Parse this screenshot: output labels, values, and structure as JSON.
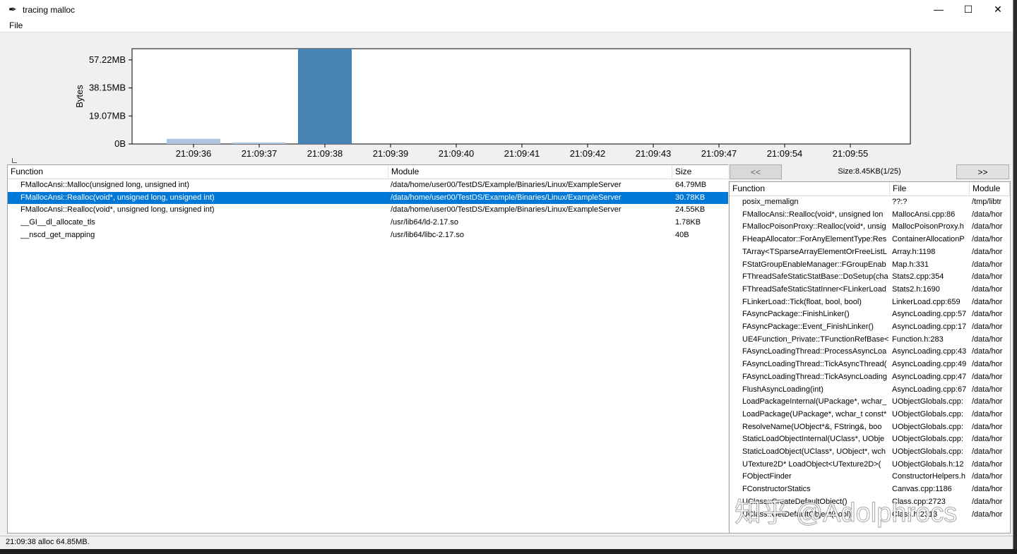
{
  "window": {
    "title": "tracing malloc",
    "menu": [
      "File"
    ],
    "minimize_icon": "minimize-icon",
    "maximize_icon": "maximize-icon",
    "close_icon": "close-icon"
  },
  "chart_data": {
    "type": "bar",
    "ylabel": "Bytes",
    "yticks": [
      "0B",
      "19.07MB",
      "38.15MB",
      "57.22MB"
    ],
    "ylim_mb": [
      0,
      64.85
    ],
    "categories": [
      "21:09:36",
      "21:09:37",
      "21:09:38",
      "21:09:39",
      "21:09:40",
      "21:09:41",
      "21:09:42",
      "21:09:43",
      "21:09:47",
      "21:09:54",
      "21:09:55"
    ],
    "values_mb": [
      3.5,
      1.0,
      64.85,
      0,
      0,
      0,
      0,
      0,
      0,
      0,
      0
    ],
    "selected_index": 2,
    "colors": {
      "normal": "#aec4dc",
      "selected": "#4682b4"
    }
  },
  "alloc_table": {
    "headers": {
      "function": "Function",
      "module": "Module",
      "size": "Size"
    },
    "rows": [
      {
        "function": "FMallocAnsi::Malloc(unsigned long, unsigned int)",
        "module": "/data/home/user00/TestDS/Example/Binaries/Linux/ExampleServer",
        "size": "64.79MB"
      },
      {
        "function": "FMallocAnsi::Realloc(void*, unsigned long, unsigned int)",
        "module": "/data/home/user00/TestDS/Example/Binaries/Linux/ExampleServer",
        "size": "30.78KB"
      },
      {
        "function": "FMallocAnsi::Realloc(void*, unsigned long, unsigned int)",
        "module": "/data/home/user00/TestDS/Example/Binaries/Linux/ExampleServer",
        "size": "24.55KB"
      },
      {
        "function": "__GI__dl_allocate_tls",
        "module": "/usr/lib64/ld-2.17.so",
        "size": "1.78KB"
      },
      {
        "function": "__nscd_get_mapping",
        "module": "/usr/lib64/libc-2.17.so",
        "size": "40B"
      }
    ],
    "selected_row": 1
  },
  "stack_panel": {
    "prev_label": "<<",
    "next_label": ">>",
    "size_label": "Size:8.45KB(1/25)",
    "headers": {
      "function": "Function",
      "file": "File",
      "module": "Module"
    },
    "rows": [
      {
        "function": "posix_memalign",
        "file": "??:?",
        "module": "/tmp/libtr"
      },
      {
        "function": "FMallocAnsi::Realloc(void*, unsigned lon",
        "file": "MallocAnsi.cpp:86",
        "module": "/data/hor"
      },
      {
        "function": "FMallocPoisonProxy::Realloc(void*, unsig",
        "file": "MallocPoisonProxy.h",
        "module": "/data/hor"
      },
      {
        "function": "FHeapAllocator::ForAnyElementType:Res",
        "file": "ContainerAllocationP",
        "module": "/data/hor"
      },
      {
        "function": "TArray<TSparseArrayElementOrFreeListL",
        "file": "Array.h:1198",
        "module": "/data/hor"
      },
      {
        "function": "FStatGroupEnableManager::FGroupEnab",
        "file": "Map.h:331",
        "module": "/data/hor"
      },
      {
        "function": "FThreadSafeStaticStatBase::DoSetup(cha",
        "file": "Stats2.cpp:354",
        "module": "/data/hor"
      },
      {
        "function": "FThreadSafeStaticStatInner<FLinkerLoad",
        "file": "Stats2.h:1690",
        "module": "/data/hor"
      },
      {
        "function": "FLinkerLoad::Tick(float, bool, bool)",
        "file": "LinkerLoad.cpp:659",
        "module": "/data/hor"
      },
      {
        "function": "FAsyncPackage::FinishLinker()",
        "file": "AsyncLoading.cpp:57",
        "module": "/data/hor"
      },
      {
        "function": "FAsyncPackage::Event_FinishLinker()",
        "file": "AsyncLoading.cpp:17",
        "module": "/data/hor"
      },
      {
        "function": "UE4Function_Private::TFunctionRefBase<",
        "file": "Function.h:283",
        "module": "/data/hor"
      },
      {
        "function": "FAsyncLoadingThread::ProcessAsyncLoa",
        "file": "AsyncLoading.cpp:43",
        "module": "/data/hor"
      },
      {
        "function": "FAsyncLoadingThread::TickAsyncThread(",
        "file": "AsyncLoading.cpp:49",
        "module": "/data/hor"
      },
      {
        "function": "FAsyncLoadingThread::TickAsyncLoading",
        "file": "AsyncLoading.cpp:47",
        "module": "/data/hor"
      },
      {
        "function": "FlushAsyncLoading(int)",
        "file": "AsyncLoading.cpp:67",
        "module": "/data/hor"
      },
      {
        "function": "LoadPackageInternal(UPackage*, wchar_",
        "file": "UObjectGlobals.cpp:",
        "module": "/data/hor"
      },
      {
        "function": "LoadPackage(UPackage*, wchar_t const*",
        "file": "UObjectGlobals.cpp:",
        "module": "/data/hor"
      },
      {
        "function": "ResolveName(UObject*&, FString&, boo",
        "file": "UObjectGlobals.cpp:",
        "module": "/data/hor"
      },
      {
        "function": "StaticLoadObjectInternal(UClass*, UObje",
        "file": "UObjectGlobals.cpp:",
        "module": "/data/hor"
      },
      {
        "function": "StaticLoadObject(UClass*, UObject*, wch",
        "file": "UObjectGlobals.cpp:",
        "module": "/data/hor"
      },
      {
        "function": "UTexture2D* LoadObject<UTexture2D>(",
        "file": "UObjectGlobals.h:12",
        "module": "/data/hor"
      },
      {
        "function": "FObjectFinder",
        "file": "ConstructorHelpers.h",
        "module": "/data/hor"
      },
      {
        "function": "FConstructorStatics",
        "file": "Canvas.cpp:1186",
        "module": "/data/hor"
      },
      {
        "function": "UClass::CreateDefaultObject()",
        "file": "Class.cpp:2723",
        "module": "/data/hor"
      },
      {
        "function": "UClass::GetDefaultObject(bool)",
        "file": "Class.h:2313",
        "module": "/data/hor"
      }
    ]
  },
  "status": {
    "text": "21:09:38 alloc 64.85MB."
  },
  "watermark": {
    "text": "知乎 @Adolphrocs"
  }
}
